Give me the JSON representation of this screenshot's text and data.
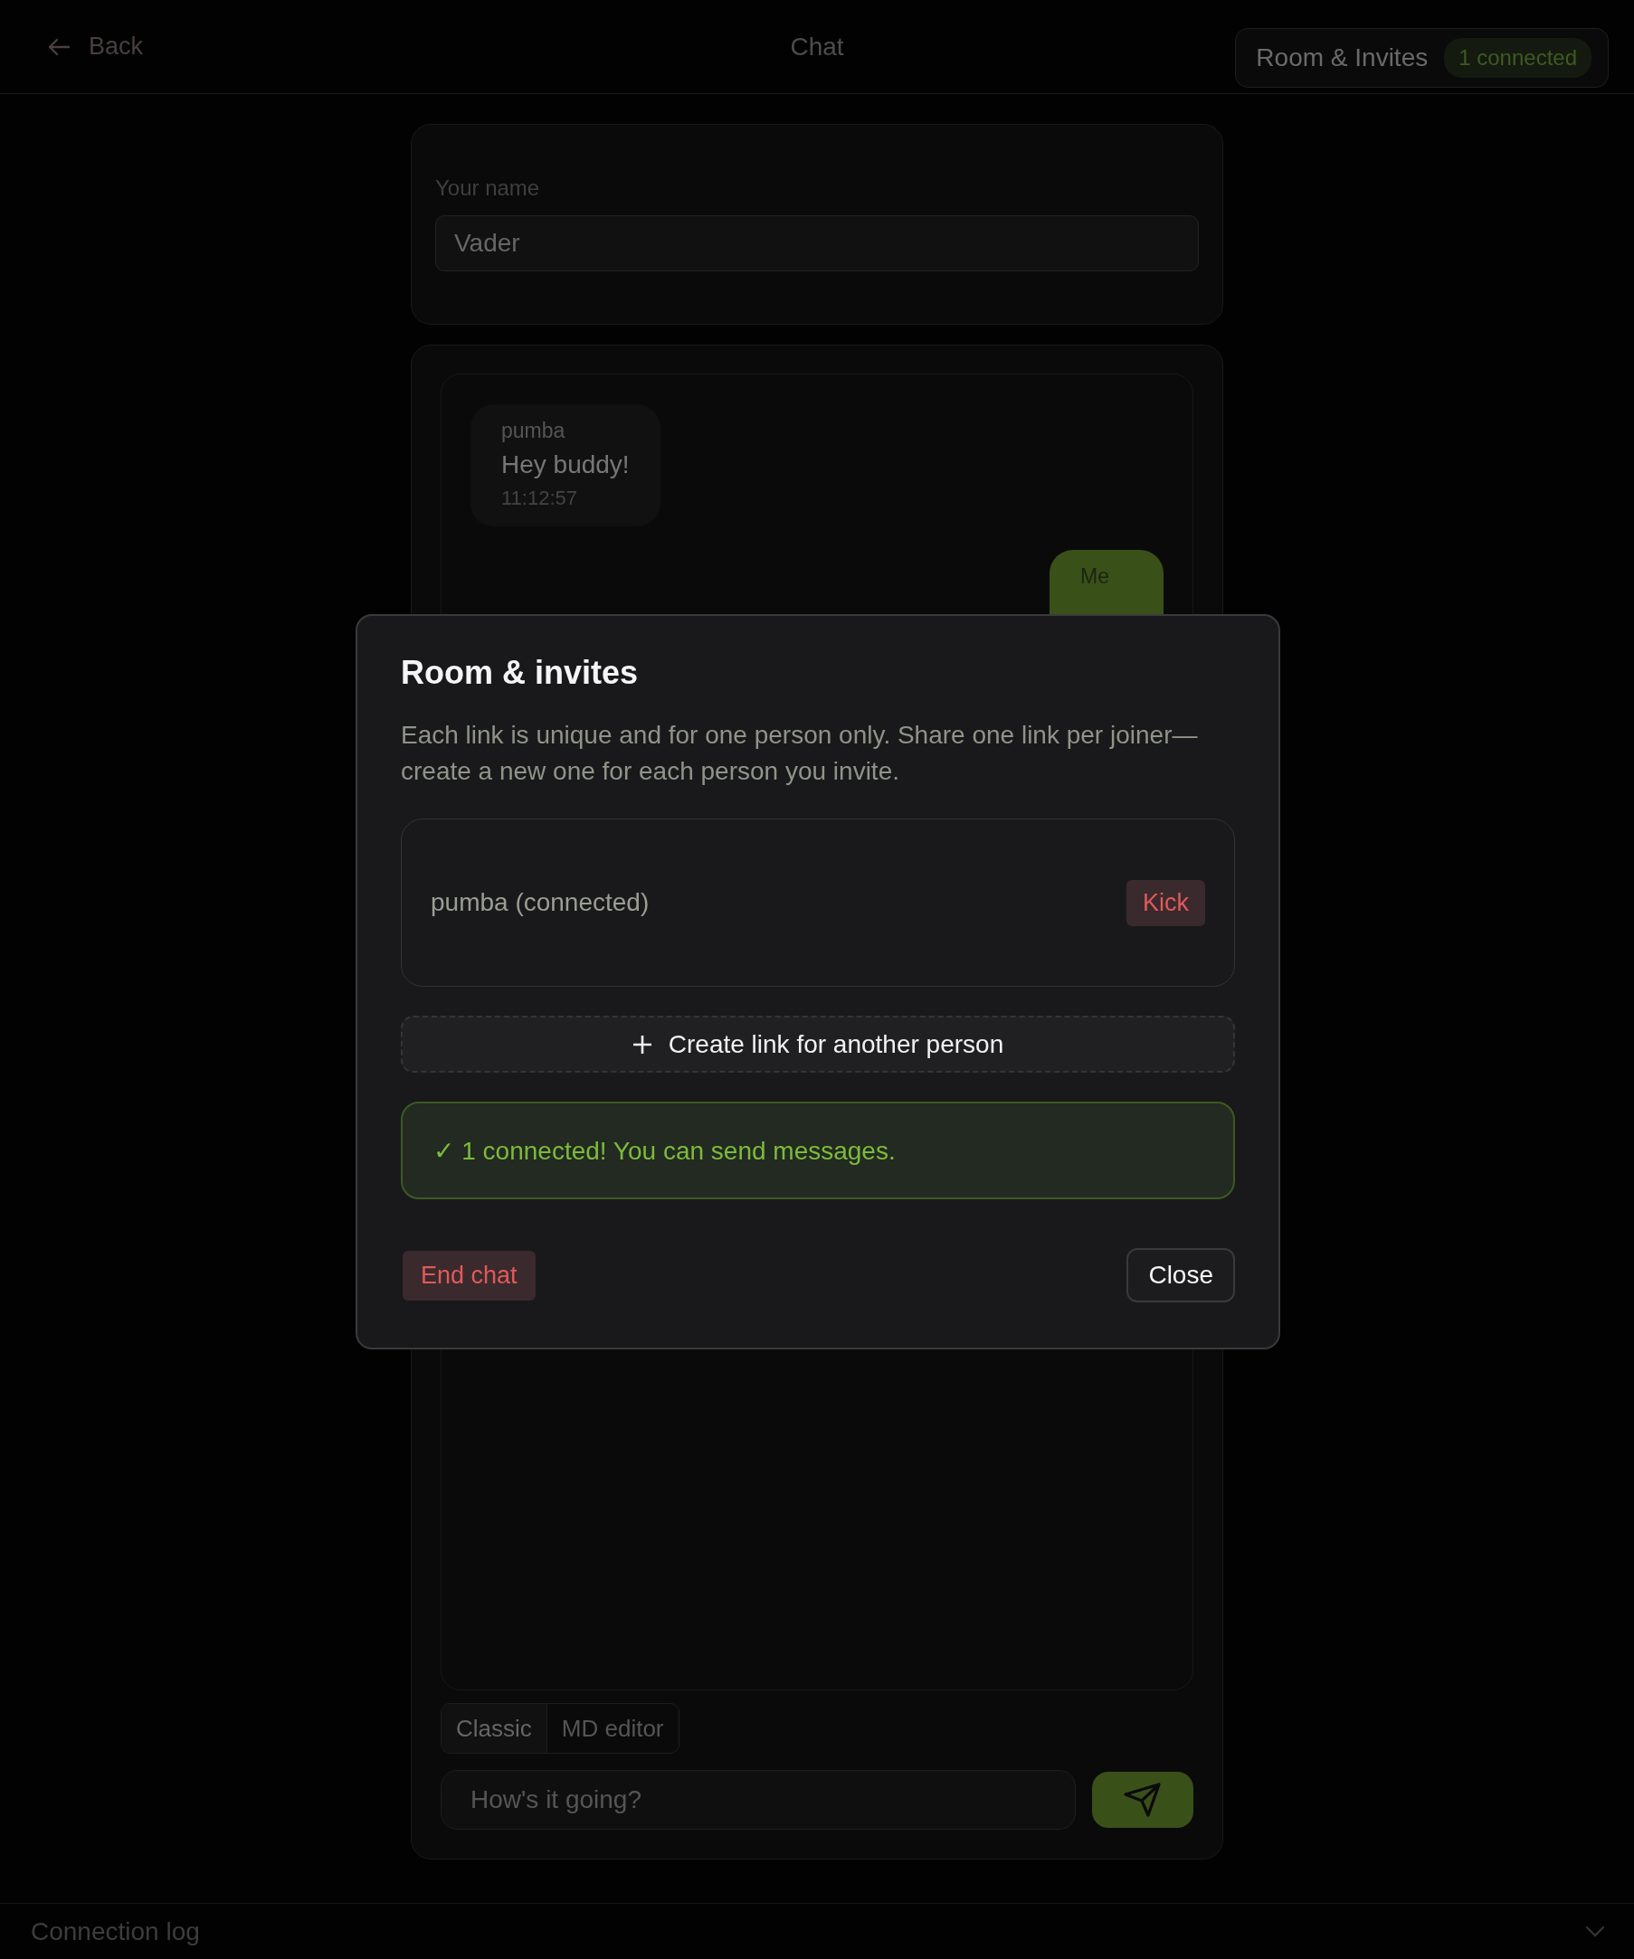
{
  "header": {
    "back": "Back",
    "title": "Chat",
    "room_button": {
      "label": "Room & Invites",
      "badge": "1 connected"
    }
  },
  "name_field": {
    "label": "Your name",
    "value": "Vader"
  },
  "messages": [
    {
      "author": "pumba",
      "text": "Hey buddy!",
      "time": "11:12:57",
      "mine": false
    },
    {
      "author": "Me",
      "mine": true
    }
  ],
  "editor_modes": [
    {
      "label": "Classic",
      "selected": true
    },
    {
      "label": "MD editor",
      "selected": false
    }
  ],
  "composer": {
    "placeholder": "How's it going?"
  },
  "connection_log": {
    "label": "Connection log",
    "expanded": false
  },
  "modal": {
    "title": "Room & invites",
    "description": "Each link is unique and for one person only. Share one link per joiner—create a new one for each person you invite.",
    "members": [
      {
        "name": "pumba (connected)",
        "action": "Kick"
      }
    ],
    "create_link": "Create link for another person",
    "status": {
      "kind": "success",
      "text": "✓ 1 connected! You can send messages."
    },
    "end_chat": "End chat",
    "close": "Close"
  }
}
